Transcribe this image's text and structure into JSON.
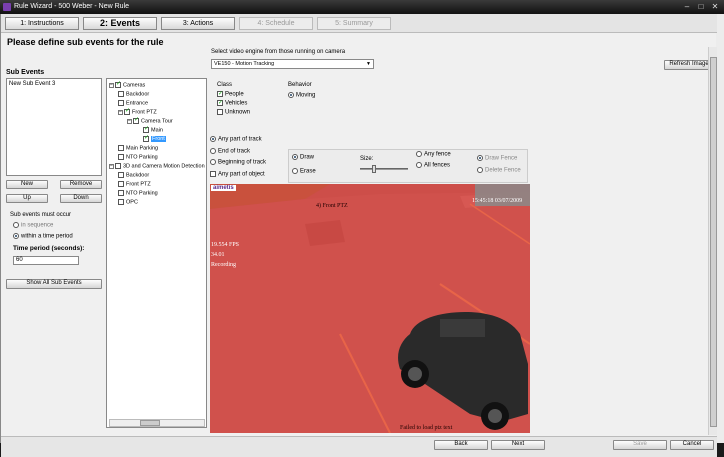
{
  "window": {
    "title": "Rule Wizard - 500 Weber - New Rule"
  },
  "steps": [
    {
      "label": "1: Instructions"
    },
    {
      "label": "2: Events"
    },
    {
      "label": "3: Actions"
    },
    {
      "label": "4: Schedule"
    },
    {
      "label": "5: Summary"
    }
  ],
  "heading": "Please define sub events for the rule",
  "sub_events": {
    "title": "Sub Events",
    "items": [
      "New Sub Event 3"
    ],
    "new_label": "New",
    "remove_label": "Remove",
    "up_label": "Up",
    "down_label": "Down",
    "must_occur_label": "Sub events must occur",
    "in_sequence_label": "in sequence",
    "within_time_label": "within a time period",
    "time_period_label": "Time period (seconds):",
    "time_period_value": "60",
    "show_all_label": "Show All Sub Events"
  },
  "tree": {
    "items": [
      {
        "label": "Cameras",
        "checked": true
      },
      {
        "label": "Backdoor",
        "checked": false
      },
      {
        "label": "Entrance",
        "checked": false
      },
      {
        "label": "Front PTZ",
        "checked": true
      },
      {
        "label": "Camera Tour",
        "checked": true
      },
      {
        "label": "Main",
        "checked": true
      },
      {
        "label": "Front",
        "checked": true
      },
      {
        "label": "Main Parking",
        "checked": false
      },
      {
        "label": "NTO Parking",
        "checked": false
      },
      {
        "label": "3D and Camera Motion Detection",
        "checked": false
      },
      {
        "label": "Backdoor",
        "checked": false
      },
      {
        "label": "Front PTZ",
        "checked": false
      },
      {
        "label": "NTO Parking",
        "checked": false
      },
      {
        "label": "OPC",
        "checked": false
      }
    ]
  },
  "engine": {
    "label": "Select video engine from those running on camera",
    "value": "VE150 - Motion Tracking",
    "refresh_label": "Refresh Image"
  },
  "class": {
    "label": "Class",
    "options": [
      {
        "label": "People",
        "checked": true
      },
      {
        "label": "Vehicles",
        "checked": true
      },
      {
        "label": "Unknown",
        "checked": false
      }
    ]
  },
  "behavior": {
    "label": "Behavior",
    "value": "Moving"
  },
  "track": {
    "options": [
      "Any part of track",
      "End of track",
      "Beginning of track"
    ],
    "any_part_object_label": "Any part of object"
  },
  "draw": {
    "draw_label": "Draw",
    "erase_label": "Erase",
    "size_label": "Size:",
    "any_fence_label": "Any fence",
    "all_fences_label": "All fences",
    "draw_fence_label": "Draw Fence",
    "delete_fence_label": "Delete Fence"
  },
  "video": {
    "logo": "aimetis",
    "camera_name": "4) Front PTZ",
    "timestamp": "15:45:18 03/07/2009",
    "fps": "19.554 FPS",
    "number": "34.01",
    "recording": "Recording",
    "error": "Failed to load ptz text",
    "colors": {
      "mask": "#e8453f",
      "ground": "#7a7a7a",
      "grass": "#5b7a3a"
    }
  },
  "footer": {
    "back_label": "Back",
    "next_label": "Next",
    "save_label": "Save",
    "cancel_label": "Cancel"
  }
}
